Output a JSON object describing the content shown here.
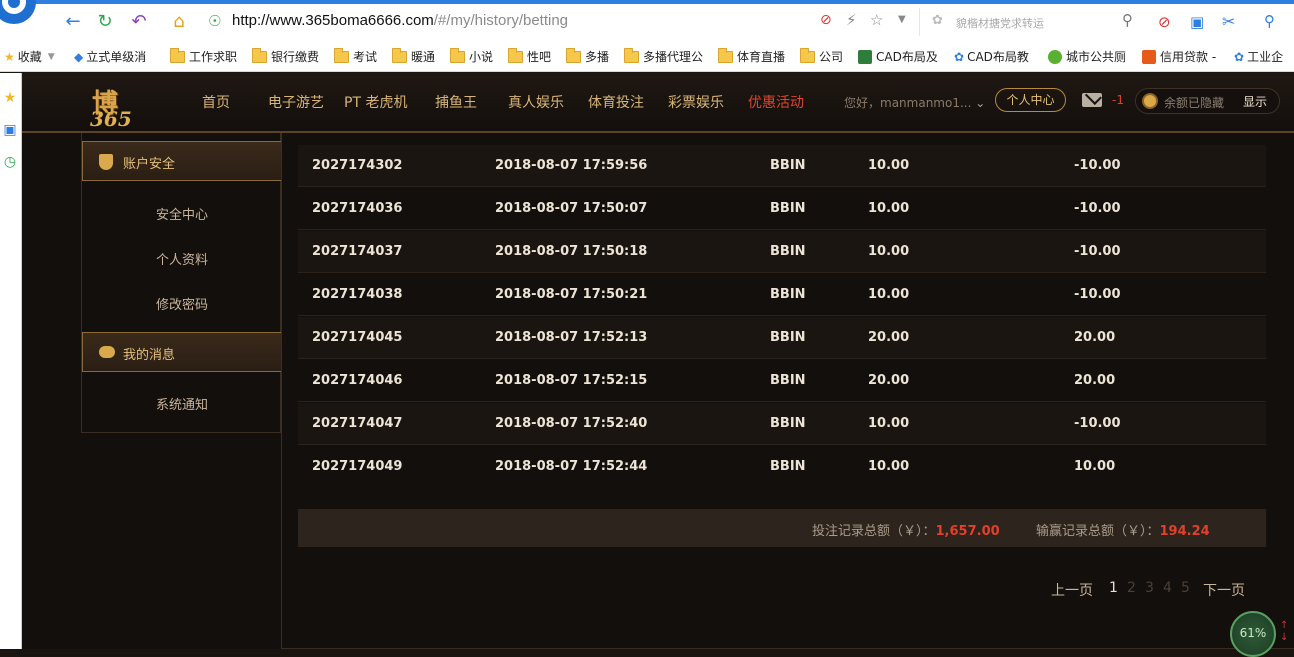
{
  "browser": {
    "url_host": "http://www.365boma6666.com",
    "url_path": "/#/my/history/betting",
    "search_placeholder": "貌楷材搪党求转运",
    "bookmarks": [
      {
        "label": "收藏",
        "icon": "star-icon"
      },
      {
        "label": "立式单级消",
        "icon": "link-icon"
      },
      {
        "label": "工作求职",
        "icon": "folder-icon"
      },
      {
        "label": "银行缴费",
        "icon": "folder-icon"
      },
      {
        "label": "考试",
        "icon": "folder-icon"
      },
      {
        "label": "暖通",
        "icon": "folder-icon"
      },
      {
        "label": "小说",
        "icon": "folder-icon"
      },
      {
        "label": "性吧",
        "icon": "folder-icon"
      },
      {
        "label": "多播",
        "icon": "folder-icon"
      },
      {
        "label": "多播代理公",
        "icon": "folder-icon"
      },
      {
        "label": "体育直播",
        "icon": "folder-icon"
      },
      {
        "label": "公司",
        "icon": "folder-icon"
      },
      {
        "label": "CAD布局及",
        "icon": "cad-icon"
      },
      {
        "label": "CAD布局教",
        "icon": "paw-icon"
      },
      {
        "label": "城市公共厕",
        "icon": "site-icon"
      },
      {
        "label": "信用贷款 -",
        "icon": "loan-icon"
      },
      {
        "label": "工业企",
        "icon": "paw-icon"
      }
    ],
    "perf_badge": "61%"
  },
  "header": {
    "logo_text": "博",
    "logo_num": "365",
    "nav": [
      "首页",
      "电子游艺",
      "PT 老虎机",
      "捕鱼王",
      "真人娱乐",
      "体育投注",
      "彩票娱乐",
      "优惠活动"
    ],
    "nav_active_index": 7,
    "greeting": "您好，manmanmo1...",
    "user_center": "个人中心",
    "mail_count": "-1",
    "balance_text": "余额已隐藏",
    "show_label": "显示"
  },
  "sidebar": {
    "section1": "账户安全",
    "items1": [
      "安全中心",
      "个人资料",
      "修改密码"
    ],
    "section2": "我的消息",
    "items2": [
      "系统通知"
    ]
  },
  "table": {
    "rows": [
      {
        "id": "2027174302",
        "time": "2018-08-07 17:59:56",
        "platform": "BBIN",
        "bet": "10.00",
        "result": "-10.00"
      },
      {
        "id": "2027174036",
        "time": "2018-08-07 17:50:07",
        "platform": "BBIN",
        "bet": "10.00",
        "result": "-10.00"
      },
      {
        "id": "2027174037",
        "time": "2018-08-07 17:50:18",
        "platform": "BBIN",
        "bet": "10.00",
        "result": "-10.00"
      },
      {
        "id": "2027174038",
        "time": "2018-08-07 17:50:21",
        "platform": "BBIN",
        "bet": "10.00",
        "result": "-10.00"
      },
      {
        "id": "2027174045",
        "time": "2018-08-07 17:52:13",
        "platform": "BBIN",
        "bet": "20.00",
        "result": "20.00"
      },
      {
        "id": "2027174046",
        "time": "2018-08-07 17:52:15",
        "platform": "BBIN",
        "bet": "20.00",
        "result": "20.00"
      },
      {
        "id": "2027174047",
        "time": "2018-08-07 17:52:40",
        "platform": "BBIN",
        "bet": "10.00",
        "result": "-10.00"
      },
      {
        "id": "2027174049",
        "time": "2018-08-07 17:52:44",
        "platform": "BBIN",
        "bet": "10.00",
        "result": "10.00"
      }
    ],
    "summary_bet_label": "投注记录总额（￥）：",
    "summary_bet_value": "1,657.00",
    "summary_win_label": "输赢记录总额（￥）：",
    "summary_win_value": "194.24"
  },
  "pagination": {
    "prev": "上一页",
    "pages": [
      "1",
      "2",
      "3",
      "4",
      "5"
    ],
    "next": "下一页"
  }
}
